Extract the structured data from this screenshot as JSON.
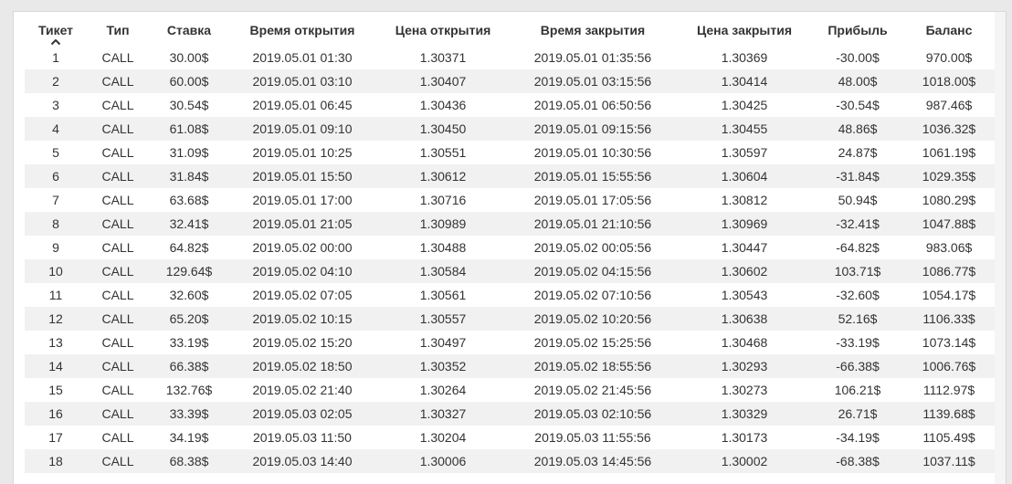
{
  "columns": [
    {
      "key": "ticket",
      "label": "Тикет"
    },
    {
      "key": "type",
      "label": "Тип"
    },
    {
      "key": "stake",
      "label": "Ставка"
    },
    {
      "key": "open_time",
      "label": "Время открытия"
    },
    {
      "key": "open_price",
      "label": "Цена открытия"
    },
    {
      "key": "close_time",
      "label": "Время закрытия"
    },
    {
      "key": "close_price",
      "label": "Цена закрытия"
    },
    {
      "key": "profit",
      "label": "Прибыль"
    },
    {
      "key": "balance",
      "label": "Баланс"
    }
  ],
  "sort": {
    "column": "ticket",
    "direction": "asc",
    "icon": "chevron-up-icon"
  },
  "rows": [
    [
      "1",
      "CALL",
      "30.00$",
      "2019.05.01 01:30",
      "1.30371",
      "2019.05.01 01:35:56",
      "1.30369",
      "-30.00$",
      "970.00$"
    ],
    [
      "2",
      "CALL",
      "60.00$",
      "2019.05.01 03:10",
      "1.30407",
      "2019.05.01 03:15:56",
      "1.30414",
      "48.00$",
      "1018.00$"
    ],
    [
      "3",
      "CALL",
      "30.54$",
      "2019.05.01 06:45",
      "1.30436",
      "2019.05.01 06:50:56",
      "1.30425",
      "-30.54$",
      "987.46$"
    ],
    [
      "4",
      "CALL",
      "61.08$",
      "2019.05.01 09:10",
      "1.30450",
      "2019.05.01 09:15:56",
      "1.30455",
      "48.86$",
      "1036.32$"
    ],
    [
      "5",
      "CALL",
      "31.09$",
      "2019.05.01 10:25",
      "1.30551",
      "2019.05.01 10:30:56",
      "1.30597",
      "24.87$",
      "1061.19$"
    ],
    [
      "6",
      "CALL",
      "31.84$",
      "2019.05.01 15:50",
      "1.30612",
      "2019.05.01 15:55:56",
      "1.30604",
      "-31.84$",
      "1029.35$"
    ],
    [
      "7",
      "CALL",
      "63.68$",
      "2019.05.01 17:00",
      "1.30716",
      "2019.05.01 17:05:56",
      "1.30812",
      "50.94$",
      "1080.29$"
    ],
    [
      "8",
      "CALL",
      "32.41$",
      "2019.05.01 21:05",
      "1.30989",
      "2019.05.01 21:10:56",
      "1.30969",
      "-32.41$",
      "1047.88$"
    ],
    [
      "9",
      "CALL",
      "64.82$",
      "2019.05.02 00:00",
      "1.30488",
      "2019.05.02 00:05:56",
      "1.30447",
      "-64.82$",
      "983.06$"
    ],
    [
      "10",
      "CALL",
      "129.64$",
      "2019.05.02 04:10",
      "1.30584",
      "2019.05.02 04:15:56",
      "1.30602",
      "103.71$",
      "1086.77$"
    ],
    [
      "11",
      "CALL",
      "32.60$",
      "2019.05.02 07:05",
      "1.30561",
      "2019.05.02 07:10:56",
      "1.30543",
      "-32.60$",
      "1054.17$"
    ],
    [
      "12",
      "CALL",
      "65.20$",
      "2019.05.02 10:15",
      "1.30557",
      "2019.05.02 10:20:56",
      "1.30638",
      "52.16$",
      "1106.33$"
    ],
    [
      "13",
      "CALL",
      "33.19$",
      "2019.05.02 15:20",
      "1.30497",
      "2019.05.02 15:25:56",
      "1.30468",
      "-33.19$",
      "1073.14$"
    ],
    [
      "14",
      "CALL",
      "66.38$",
      "2019.05.02 18:50",
      "1.30352",
      "2019.05.02 18:55:56",
      "1.30293",
      "-66.38$",
      "1006.76$"
    ],
    [
      "15",
      "CALL",
      "132.76$",
      "2019.05.02 21:40",
      "1.30264",
      "2019.05.02 21:45:56",
      "1.30273",
      "106.21$",
      "1112.97$"
    ],
    [
      "16",
      "CALL",
      "33.39$",
      "2019.05.03 02:05",
      "1.30327",
      "2019.05.03 02:10:56",
      "1.30329",
      "26.71$",
      "1139.68$"
    ],
    [
      "17",
      "CALL",
      "34.19$",
      "2019.05.03 11:50",
      "1.30204",
      "2019.05.03 11:55:56",
      "1.30173",
      "-34.19$",
      "1105.49$"
    ],
    [
      "18",
      "CALL",
      "68.38$",
      "2019.05.03 14:40",
      "1.30006",
      "2019.05.03 14:45:56",
      "1.30002",
      "-68.38$",
      "1037.11$"
    ]
  ]
}
